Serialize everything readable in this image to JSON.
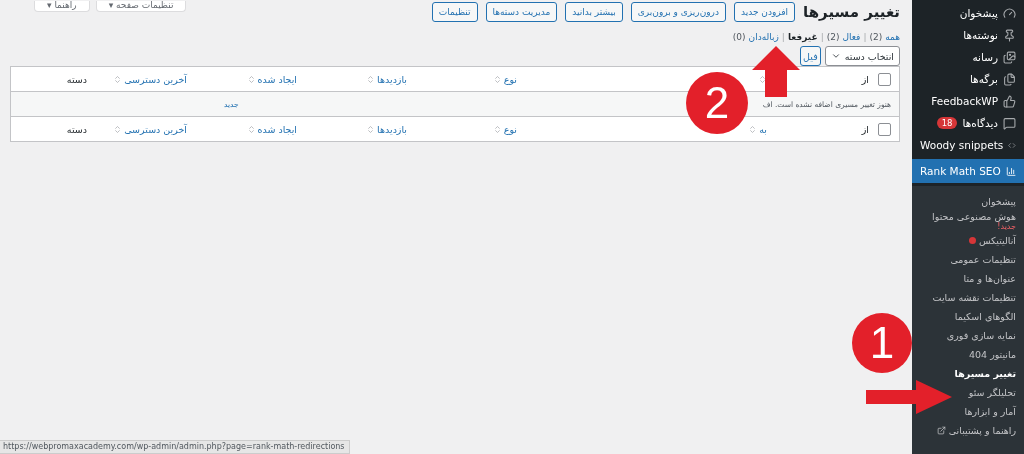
{
  "top_buttons": [
    "تنظیمات صفحه ▾",
    "راهنما ▾"
  ],
  "page": {
    "title": "تغییر مسیرها",
    "actions": [
      "افزودن جدید",
      "درون‌ریزی و برون‌بری",
      "بیشتر بدانید",
      "مدیریت دسته‌ها",
      "تنظیمات"
    ]
  },
  "status_filters": [
    {
      "label": "همه",
      "count": "(2)",
      "selected": false
    },
    {
      "separator": "|",
      "label": "فعال",
      "count": "(2)",
      "selected": false
    },
    {
      "separator": "|",
      "label": "غیرفعا",
      "selected": true
    },
    {
      "separator": "|",
      "label": "زباله‌دان",
      "count": "(0)",
      "selected": false
    }
  ],
  "bulk": {
    "select": "انتخاب دسته",
    "filter_button": "فیل"
  },
  "table": {
    "header_select": {
      "checked": false
    },
    "footer_select": {
      "checked": false
    },
    "header": [
      {
        "label": "از",
        "sortable": false
      },
      {
        "sortable": true
      },
      {
        "label": "نوع",
        "sortable": true
      },
      {
        "label": "بازدیدها",
        "sortable": true
      },
      {
        "label": "ایجاد شده",
        "sortable": true
      },
      {
        "label": "آخرین دسترسی",
        "sortable": true
      },
      {
        "label": "دسته",
        "sortable": false
      }
    ],
    "empty_message": "هنوز تغییر مسیری اضافه نشده است. اف",
    "empty_link": "جدید",
    "footer": [
      {
        "label": "از",
        "sortable": false
      },
      {
        "label": "به",
        "sortable": true
      },
      {
        "label": "نوع",
        "sortable": true
      },
      {
        "label": "بازدیدها",
        "sortable": true
      },
      {
        "label": "ایجاد شده",
        "sortable": true
      },
      {
        "label": "آخرین دسترسی",
        "sortable": true
      },
      {
        "label": "دسته",
        "sortable": false
      }
    ]
  },
  "status_url": "https://webpromaxacademy.com/wp-admin/admin.php?page=rank-math-redirections",
  "sidebar": {
    "items": [
      {
        "label": "پیشخوان",
        "active": false
      },
      {
        "label": "نوشته‌ها",
        "active": false
      },
      {
        "label": "رسانه",
        "active": false
      },
      {
        "label": "برگه‌ها",
        "active": false
      },
      {
        "label": "FeedbackWP",
        "active": false
      },
      {
        "label": "دیدگاه‌ها",
        "badge": "18",
        "active": false
      },
      {
        "label": "Woody snippets",
        "active": false
      },
      {
        "label": "Rank Math SEO",
        "active": true
      }
    ],
    "submenu": [
      {
        "label": "پیشخوان",
        "selected": false
      },
      {
        "label": "هوش مصنوعی محتوا",
        "note": "جدید!",
        "selected": false
      },
      {
        "label": "آنالیتیکس",
        "alert": true,
        "selected": false
      },
      {
        "label": "تنظیمات عمومی",
        "selected": false
      },
      {
        "label": "عنوان‌ها و متا",
        "selected": false
      },
      {
        "label": "تنظیمات نقشه سایت",
        "selected": false
      },
      {
        "label": "الگوهای اسکیما",
        "selected": false
      },
      {
        "label": "نمایه سازی فوری",
        "selected": false
      },
      {
        "label": "مانیتور 404",
        "selected": false
      },
      {
        "label": "تغییر مسیرها",
        "selected": true
      },
      {
        "label": "تحلیلگر سئو",
        "selected": false
      },
      {
        "label": "آمار و ابزارها",
        "selected": false
      },
      {
        "label": "راهنما و پشتیبانی",
        "external": true,
        "selected": false
      }
    ]
  },
  "annotations": [
    {
      "label": "2",
      "kind": "up"
    },
    {
      "label": "1",
      "kind": "right"
    }
  ]
}
